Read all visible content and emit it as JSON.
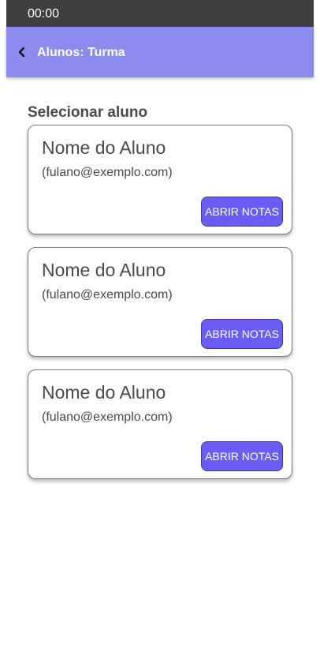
{
  "status_bar": {
    "time": "00:00"
  },
  "app_bar": {
    "back_icon": "chevron-left-icon",
    "title": "Alunos: Turma"
  },
  "section": {
    "title": "Selecionar aluno"
  },
  "students": [
    {
      "name": "Nome do Aluno",
      "email": "(fulano@exemplo.com)",
      "button_label": "ABRIR NOTAS"
    },
    {
      "name": "Nome do Aluno",
      "email": "(fulano@exemplo.com)",
      "button_label": "ABRIR NOTAS"
    },
    {
      "name": "Nome do Aluno",
      "email": "(fulano@exemplo.com)",
      "button_label": "ABRIR NOTAS"
    }
  ],
  "colors": {
    "status_bar": "#3f3f3f",
    "app_bar": "#8b8bef",
    "button": "#6b5cf6",
    "text": "#4a4a4a"
  }
}
